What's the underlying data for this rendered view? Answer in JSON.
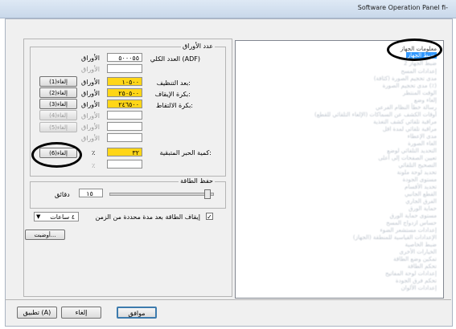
{
  "window": {
    "title": "Software Operation Panel fi-"
  },
  "sheet": {
    "group_title": "عدد الأوراق",
    "total_label": "العدد الكلي (ADF)",
    "total_value": "٥٠٠٠٥٥",
    "unit_sheets": "الأوراق",
    "unit_percent": "٪",
    "clean_label": "بعد التنظيف:",
    "clean_value": "١٠٥٠٠",
    "brake_label": "بكرة الإيقاف:",
    "brake_value": "٢٥٠٥٠٠",
    "pick_label": "بكرة الالتقاط:",
    "pick_value": "٢٤٦٥٠٠",
    "ink_label": "كمية الحبر المتبقية:",
    "ink_value": "٣٢",
    "clear1": "إلغاء(1)",
    "clear2": "إلغاء(2)",
    "clear3": "إلغاء(3)",
    "clear4": "إلغاء(4)",
    "clear5": "إلغاء(5)",
    "clear6": "إلغاء(6)"
  },
  "power": {
    "group_title": "حفظ الطاقة",
    "minutes_value": "١٥",
    "minutes_unit": "دقائق",
    "auto_off_label": "إيقاف الطاقة بعد مدة محددة من الزمن",
    "auto_off_checked": true,
    "hours_option": "٤ ساعات",
    "reset_button": "أوضبت..."
  },
  "tree": {
    "item_info": "معلومات الجهاز",
    "item_settings": "ضبط الجهاز",
    "item_settings2": "ضبط الجهاز 2",
    "blurred_items": [
      "إعدادات المسح",
      "مدى تحجيم الصورة (كثافة)",
      "مدى تحجيم الصورة (٪)",
      "الوقت المنتظر",
      "إلغاء وضع",
      "رسالة خطأ النظام الفرعي",
      "أوقات الكشف عن السماكات (الإلغاء التلقائي للقطع)",
      "مراقبة تلقائي كشف التغذية",
      "مراقبة تلقائي لمدة اقل",
      "مدى الإعطاء",
      "الغاء الصورة",
      "التحديد التلقائي لوضع",
      "تعيين الصفحات إلى أعلى",
      "التصحيح التلقائي",
      "تحديد لوحة ملونة",
      "مستوى الجودة",
      "تحديد الأقسام",
      "القطع الجانبي",
      "الفرق الجاري",
      "حماية الورق",
      "مستوى حماية الورق",
      "حساس ازدواج المسح",
      "إعدادات مستشعر الضوء",
      "الإعدادات القياسية للمنطقة (الجهاز)",
      "ضبط الخاصية",
      "الخيارات الأخرى",
      "تمكين وضع الطاقة",
      "تحكم الطاقة",
      "إعدادات لوحة المفاتيح",
      "تحكم فرق الجودة",
      "إعدادات الألوان"
    ]
  },
  "bottom": {
    "ok": "موافق",
    "cancel": "إلغاء",
    "apply": "تطبيق (A)"
  }
}
